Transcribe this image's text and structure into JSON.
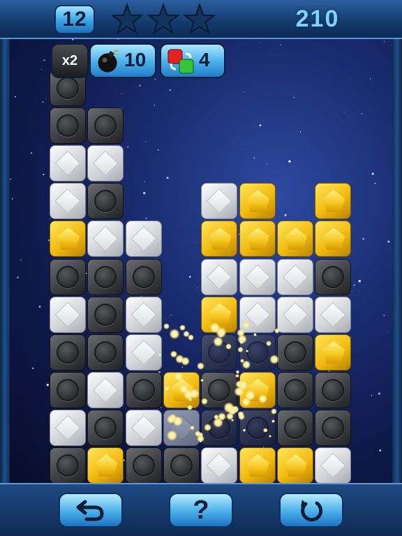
{
  "header": {
    "level": "12",
    "stars_earned": 0,
    "stars_total": 3,
    "score": "210"
  },
  "powerups": {
    "multiplier_label": "x2",
    "bomb_count": "10",
    "swap_count": "4"
  },
  "board": {
    "columns": 9,
    "rows": 12,
    "blocks": [
      {
        "c": 0,
        "r": 0,
        "t": "dark"
      },
      {
        "c": 0,
        "r": 1,
        "t": "dark"
      },
      {
        "c": 1,
        "r": 1,
        "t": "dark"
      },
      {
        "c": 0,
        "r": 2,
        "t": "white"
      },
      {
        "c": 1,
        "r": 2,
        "t": "white"
      },
      {
        "c": 0,
        "r": 3,
        "t": "white"
      },
      {
        "c": 1,
        "r": 3,
        "t": "dark"
      },
      {
        "c": 4,
        "r": 3,
        "t": "white"
      },
      {
        "c": 5,
        "r": 3,
        "t": "yellow"
      },
      {
        "c": 7,
        "r": 3,
        "t": "yellow"
      },
      {
        "c": 0,
        "r": 4,
        "t": "yellow"
      },
      {
        "c": 1,
        "r": 4,
        "t": "white"
      },
      {
        "c": 2,
        "r": 4,
        "t": "white"
      },
      {
        "c": 4,
        "r": 4,
        "t": "yellow"
      },
      {
        "c": 5,
        "r": 4,
        "t": "yellow"
      },
      {
        "c": 6,
        "r": 4,
        "t": "yellow"
      },
      {
        "c": 7,
        "r": 4,
        "t": "yellow"
      },
      {
        "c": 0,
        "r": 5,
        "t": "dark"
      },
      {
        "c": 1,
        "r": 5,
        "t": "dark"
      },
      {
        "c": 2,
        "r": 5,
        "t": "dark"
      },
      {
        "c": 4,
        "r": 5,
        "t": "white"
      },
      {
        "c": 5,
        "r": 5,
        "t": "white"
      },
      {
        "c": 6,
        "r": 5,
        "t": "white"
      },
      {
        "c": 7,
        "r": 5,
        "t": "dark"
      },
      {
        "c": 0,
        "r": 6,
        "t": "white"
      },
      {
        "c": 1,
        "r": 6,
        "t": "dark"
      },
      {
        "c": 2,
        "r": 6,
        "t": "white"
      },
      {
        "c": 4,
        "r": 6,
        "t": "yellow"
      },
      {
        "c": 5,
        "r": 6,
        "t": "white"
      },
      {
        "c": 6,
        "r": 6,
        "t": "white"
      },
      {
        "c": 7,
        "r": 6,
        "t": "white"
      },
      {
        "c": 0,
        "r": 7,
        "t": "dark"
      },
      {
        "c": 1,
        "r": 7,
        "t": "dark"
      },
      {
        "c": 2,
        "r": 7,
        "t": "white"
      },
      {
        "c": 4,
        "r": 7,
        "t": "dark"
      },
      {
        "c": 5,
        "r": 7,
        "t": "dark"
      },
      {
        "c": 6,
        "r": 7,
        "t": "dark"
      },
      {
        "c": 7,
        "r": 7,
        "t": "yellow"
      },
      {
        "c": 0,
        "r": 8,
        "t": "dark"
      },
      {
        "c": 1,
        "r": 8,
        "t": "white"
      },
      {
        "c": 2,
        "r": 8,
        "t": "dark"
      },
      {
        "c": 3,
        "r": 8,
        "t": "yellow"
      },
      {
        "c": 4,
        "r": 8,
        "t": "dark"
      },
      {
        "c": 5,
        "r": 8,
        "t": "yellow"
      },
      {
        "c": 6,
        "r": 8,
        "t": "dark"
      },
      {
        "c": 7,
        "r": 8,
        "t": "dark"
      },
      {
        "c": 0,
        "r": 9,
        "t": "white"
      },
      {
        "c": 1,
        "r": 9,
        "t": "dark"
      },
      {
        "c": 2,
        "r": 9,
        "t": "white"
      },
      {
        "c": 3,
        "r": 9,
        "t": "white"
      },
      {
        "c": 4,
        "r": 9,
        "t": "dark"
      },
      {
        "c": 5,
        "r": 9,
        "t": "dark"
      },
      {
        "c": 6,
        "r": 9,
        "t": "dark"
      },
      {
        "c": 7,
        "r": 9,
        "t": "dark"
      },
      {
        "c": 0,
        "r": 10,
        "t": "dark"
      },
      {
        "c": 1,
        "r": 10,
        "t": "yellow"
      },
      {
        "c": 2,
        "r": 10,
        "t": "dark"
      },
      {
        "c": 3,
        "r": 10,
        "t": "dark"
      },
      {
        "c": 4,
        "r": 10,
        "t": "white"
      },
      {
        "c": 5,
        "r": 10,
        "t": "yellow"
      },
      {
        "c": 6,
        "r": 10,
        "t": "yellow"
      },
      {
        "c": 7,
        "r": 10,
        "t": "white"
      }
    ]
  },
  "controls": {
    "undo_icon": "undo-arrow-icon",
    "help_label": "?",
    "restart_icon": "restart-icon"
  },
  "colors": {
    "accent": "#4aaeea",
    "score_text": "#7ed4ff",
    "yellow_block": "#f2bb12",
    "dark_block": "#3a3c40",
    "white_block": "#d9dcdf"
  }
}
